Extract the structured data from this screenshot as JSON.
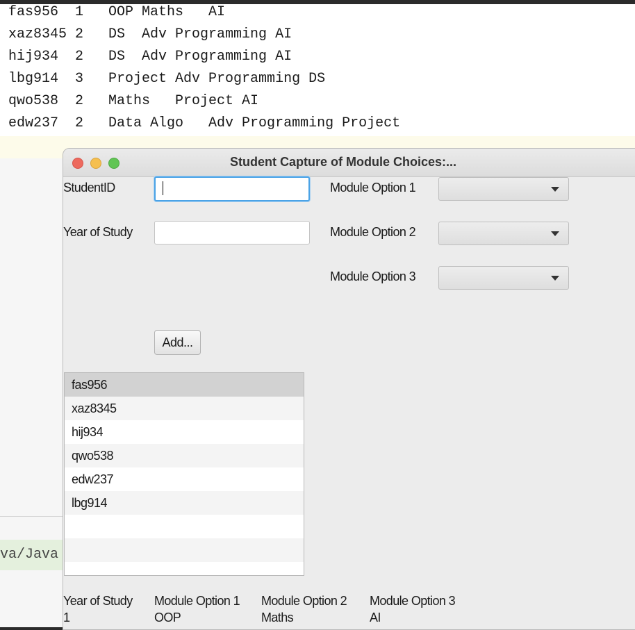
{
  "background_file": {
    "lines": [
      "fas956  1   OOP Maths   AI",
      "xaz8345 2   DS  Adv Programming AI",
      "hij934  2   DS  Adv Programming AI",
      "lbg914  3   Project Adv Programming DS",
      "qwo538  2   Maths   Project AI",
      "edw237  2   Data Algo   Adv Programming Project"
    ],
    "path_fragment": "va/Java"
  },
  "window": {
    "title": "Student Capture of Module Choices:...",
    "form": {
      "student_id_label": "StudentID",
      "student_id_value": "",
      "year_label": "Year of Study",
      "year_value": "",
      "module_option_1_label": "Module Option 1",
      "module_option_2_label": "Module Option 2",
      "module_option_3_label": "Module Option 3",
      "add_button_label": "Add..."
    },
    "student_list": [
      "fas956",
      "xaz8345",
      "hij934",
      "qwo538",
      "edw237",
      "lbg914"
    ],
    "details": {
      "year_header": "Year of Study",
      "module_1_header": "Module Option 1",
      "module_2_header": "Module Option 2",
      "module_3_header": "Module Option 3",
      "year_value": "1",
      "module_1_value": "OOP",
      "module_2_value": "Maths",
      "module_3_value": "AI"
    }
  }
}
